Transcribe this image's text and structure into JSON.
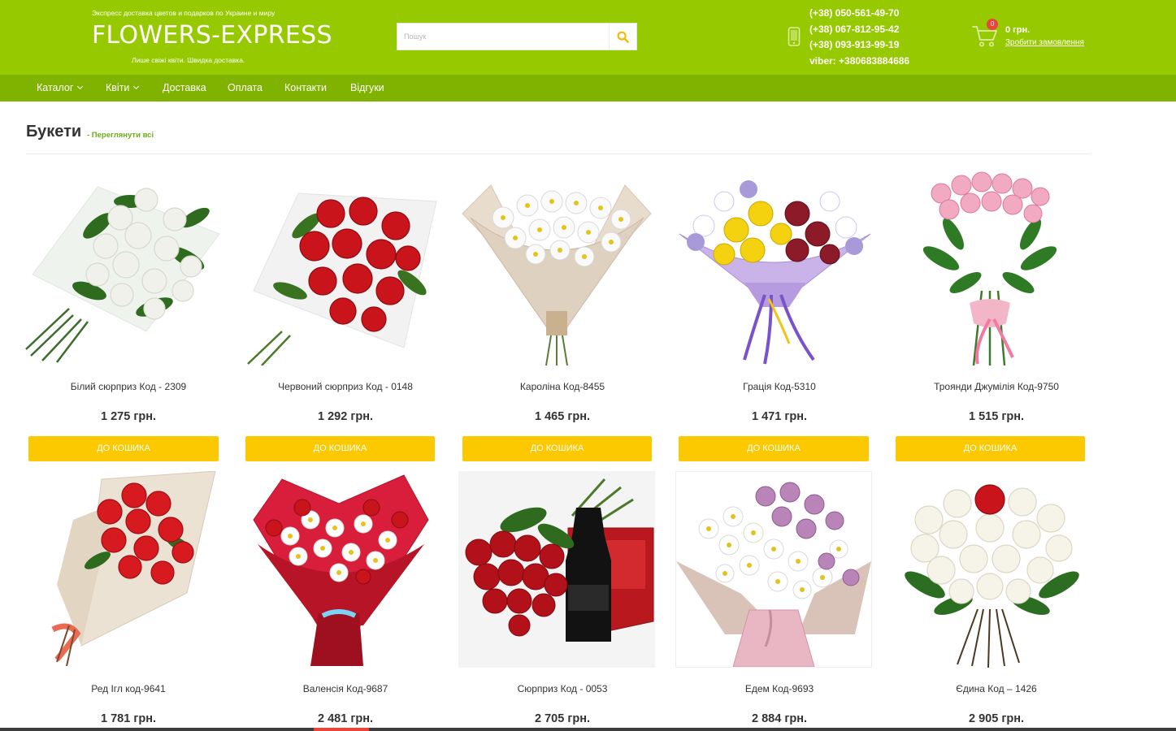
{
  "header": {
    "tagline": "Экспресс доставка цветов и подарков по Украине и миру",
    "logo": "FLOWERS-EXPRESS",
    "slogan": "Лише свіжі квіти. Швидка доставка.",
    "search_placeholder": "Пошук",
    "phones": [
      "(+38) 050-561-49-70",
      "(+38) 067-812-95-42",
      "(+38) 093-913-99-19",
      "viber: +380683884686"
    ],
    "cart": {
      "count": "0",
      "total": "0 грн.",
      "checkout_link": "Зробити замовлення"
    },
    "colors": {
      "header_bg": "#97c901",
      "nav_bg": "#80b300",
      "button_yellow": "#fcc800",
      "link_green": "#6faa17",
      "badge_red": "#e9453b"
    }
  },
  "nav": {
    "items": [
      {
        "label": "Каталог",
        "dropdown": true
      },
      {
        "label": "Квіти",
        "dropdown": true
      },
      {
        "label": "Доставка",
        "dropdown": false
      },
      {
        "label": "Оплата",
        "dropdown": false
      },
      {
        "label": "Контакти",
        "dropdown": false
      },
      {
        "label": "Відгуки",
        "dropdown": false
      }
    ]
  },
  "section": {
    "title": "Букети",
    "view_all": "- Переглянути всі"
  },
  "products": [
    {
      "name": "Білий сюрприз Код - 2309",
      "price": "1 275 грн.",
      "button": "ДО КОШИКА",
      "image": "white-roses-bouquet"
    },
    {
      "name": "Червоний сюрприз Код - 0148",
      "price": "1 292 грн.",
      "button": "ДО КОШИКА",
      "image": "red-roses-bouquet"
    },
    {
      "name": "Кароліна Код-8455",
      "price": "1 465 грн.",
      "button": "ДО КОШИКА",
      "image": "white-chrysanthemums-kraft"
    },
    {
      "name": "Грація Код-5310",
      "price": "1 471 грн.",
      "button": "ДО КОШИКА",
      "image": "mixed-chrysanthemums-purple-ribbon"
    },
    {
      "name": "Троянди Джумілія Код-9750",
      "price": "1 515 грн.",
      "button": "ДО КОШИКА",
      "image": "pink-roses-bouquet"
    },
    {
      "name": "Ред Ігл код-9641",
      "price": "1 781 грн.",
      "image": "red-roses-kraft"
    },
    {
      "name": "Валенсія Код-9687",
      "price": "2 481 грн.",
      "image": "red-white-mix-bouquet"
    },
    {
      "name": "Сюрприз Код - 0053",
      "price": "2 705 грн.",
      "image": "roses-champagne-chocolates"
    },
    {
      "name": "Едем Код-9693",
      "price": "2 884 грн.",
      "image": "chrysanthemums-pink-wrap"
    },
    {
      "name": "Єдина Код – 1426",
      "price": "2 905 грн.",
      "image": "white-roses-one-red"
    }
  ]
}
